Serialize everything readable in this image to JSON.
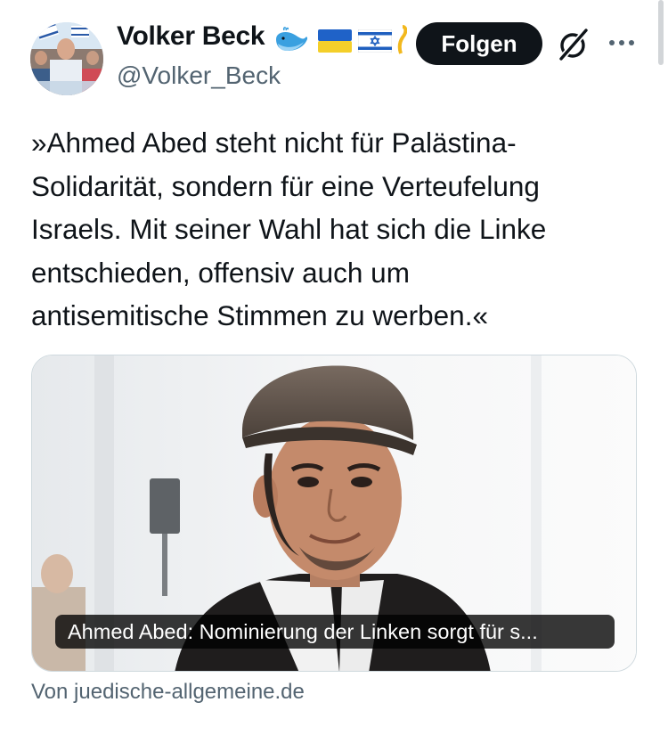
{
  "author": {
    "name": "Volker Beck",
    "handle": "@Volker_Beck",
    "badges": [
      "whale-emoji",
      "ukraine-flag",
      "israel-flag",
      "yellow-ribbon"
    ]
  },
  "actions": {
    "follow_label": "Folgen",
    "icons": [
      "grok-icon",
      "more-icon"
    ]
  },
  "tweet": {
    "text": "»Ahmed Abed steht nicht für Palästina-\nSolidarität, sondern für eine Verteufelung\nIsraels. Mit seiner Wahl hat sich die Linke\nentschieden, offensiv auch um\nantisemitische Stimmen zu werben.«"
  },
  "link_card": {
    "caption": "Ahmed Abed: Nominierung der Linken sorgt für s...",
    "source": "Von juedische-allgemeine.de"
  },
  "colors": {
    "text": "#0f1419",
    "secondary": "#536471",
    "button_bg": "#0f1419",
    "border": "#cfd9de"
  }
}
